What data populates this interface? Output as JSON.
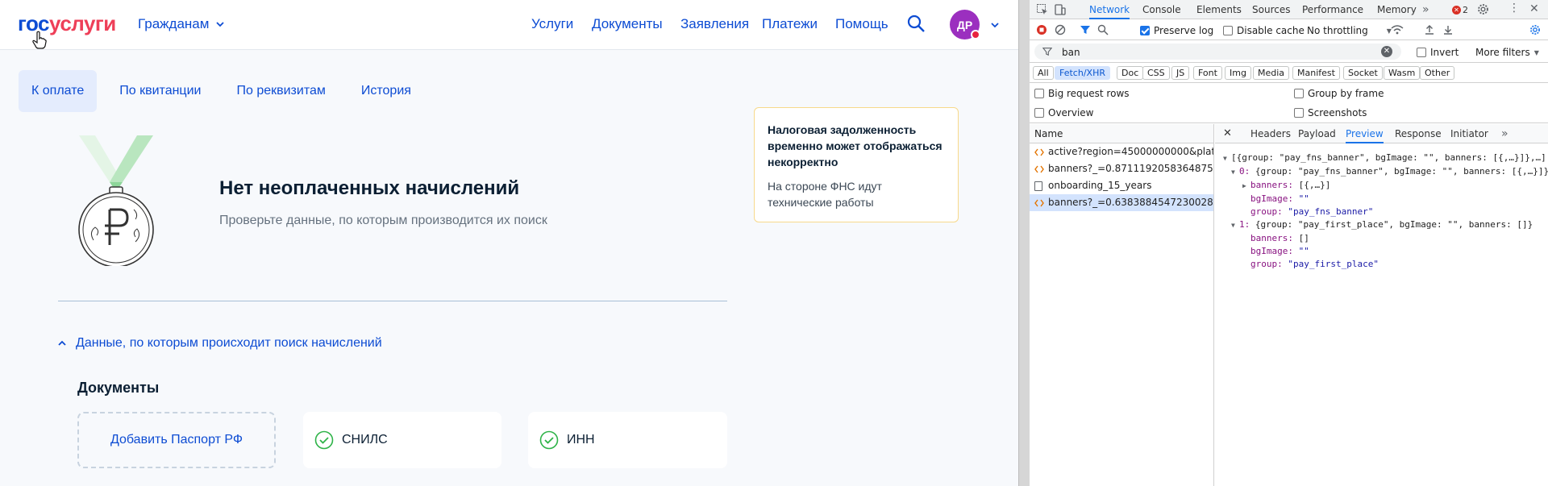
{
  "site": {
    "logo_part1": "гос",
    "logo_part2": "услуги",
    "citizen_menu": "Гражданам",
    "nav": [
      "Услуги",
      "Документы",
      "Заявления",
      "Платежи",
      "Помощь"
    ],
    "avatar_initials": "ДР",
    "tabs": [
      "К оплате",
      "По квитанции",
      "По реквизитам",
      "История"
    ],
    "empty_title": "Нет неоплаченных начислений",
    "empty_subtitle": "Проверьте данные, по которым производится их поиск",
    "notice_title": "Налоговая задолженность временно может отображаться некорректно",
    "notice_body": "На стороне ФНС идут технические работы",
    "search_data_toggle": "Данные, по которым происходит поиск начислений",
    "documents_title": "Документы",
    "add_passport": "Добавить Паспорт РФ",
    "doc_snils": "СНИЛС",
    "doc_inn": "ИНН"
  },
  "devtools": {
    "tabs": [
      "Network",
      "Console",
      "Elements",
      "Sources",
      "Performance",
      "Memory"
    ],
    "error_count": "2",
    "preserve_log": "Preserve log",
    "disable_cache": "Disable cache",
    "throttling": "No throttling",
    "filter_value": "ban",
    "invert": "Invert",
    "more_filters": "More filters",
    "type_filters": [
      "All",
      "Fetch/XHR",
      "Doc",
      "CSS",
      "JS",
      "Font",
      "Img",
      "Media",
      "Manifest",
      "Socket",
      "Wasm",
      "Other"
    ],
    "opt_big_rows": "Big request rows",
    "opt_group_frame": "Group by frame",
    "opt_overview": "Overview",
    "opt_screenshots": "Screenshots",
    "list_header": "Name",
    "requests": [
      "active?region=45000000000&platfo...",
      "banners?_=0.8711192058364875&g...",
      "onboarding_15_years",
      "banners?_=0.6383884547230028&g..."
    ],
    "detail_tabs": [
      "Headers",
      "Payload",
      "Preview",
      "Response",
      "Initiator"
    ],
    "json": {
      "l1": "[{group: \"pay_fns_banner\", bgImage: \"\", banners: [{,…}]},…]",
      "l2_idx": "0:",
      "l2": " {group: \"pay_fns_banner\", bgImage: \"\", banners: [{,…}]}",
      "l3_key": "banners:",
      "l3_val": " [{,…}]",
      "l4_key": "bgImage:",
      "l4_val": " \"\"",
      "l5_key": "group:",
      "l5_val": " \"pay_fns_banner\"",
      "l6_idx": "1:",
      "l6": " {group: \"pay_first_place\", bgImage: \"\", banners: []}",
      "l7_key": "banners:",
      "l7_val": " []",
      "l8_key": "bgImage:",
      "l8_val": " \"\"",
      "l9_key": "group:",
      "l9_val": " \"pay_first_place\""
    }
  }
}
